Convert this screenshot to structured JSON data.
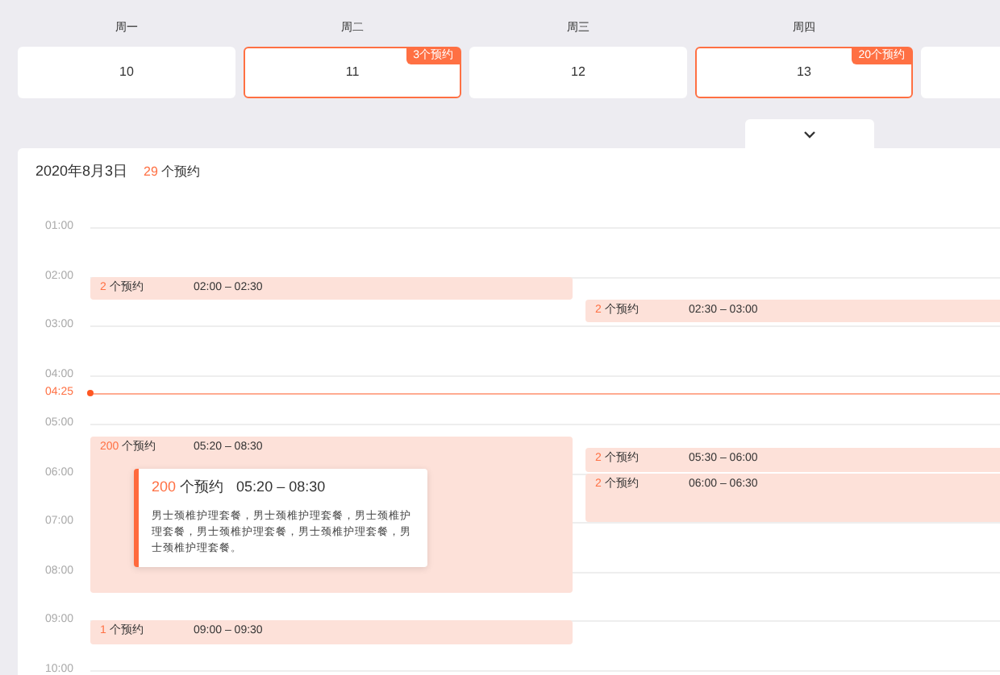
{
  "week": [
    {
      "weekday": "周一",
      "date": "10",
      "selected": false
    },
    {
      "weekday": "周二",
      "date": "11",
      "selected": true,
      "badge": "3个预约"
    },
    {
      "weekday": "周三",
      "date": "12",
      "selected": false
    },
    {
      "weekday": "周四",
      "date": "13",
      "selected": true,
      "badge": "20个预约"
    },
    {
      "selected": false
    }
  ],
  "header": {
    "date": "2020年8月3日",
    "count": "29",
    "count_unit": "个预约"
  },
  "hours": [
    "01:00",
    "02:00",
    "03:00",
    "04:00",
    "05:00",
    "06:00",
    "07:00",
    "08:00",
    "09:00",
    "10:00"
  ],
  "now": {
    "label": "04:25"
  },
  "events": [
    {
      "count": "2",
      "unit": "个预约",
      "time": "02:00 – 02:30"
    },
    {
      "count": "2",
      "unit": "个预约",
      "time": "02:30 – 03:00"
    },
    {
      "count": "200",
      "unit": "个预约",
      "time": "05:20 – 08:30",
      "detail": {
        "count": "200",
        "unit": "个预约",
        "time": "05:20 – 08:30",
        "description": "男士颈椎护理套餐，男士颈椎护理套餐，男士颈椎护理套餐，男士颈椎护理套餐，男士颈椎护理套餐，男士颈椎护理套餐。"
      }
    },
    {
      "count": "2",
      "unit": "个预约",
      "time": "05:30 – 06:00"
    },
    {
      "count": "2",
      "unit": "个预约",
      "time": "06:00 – 06:30"
    },
    {
      "count": "1",
      "unit": "个预约",
      "time": "09:00 – 09:30"
    }
  ]
}
